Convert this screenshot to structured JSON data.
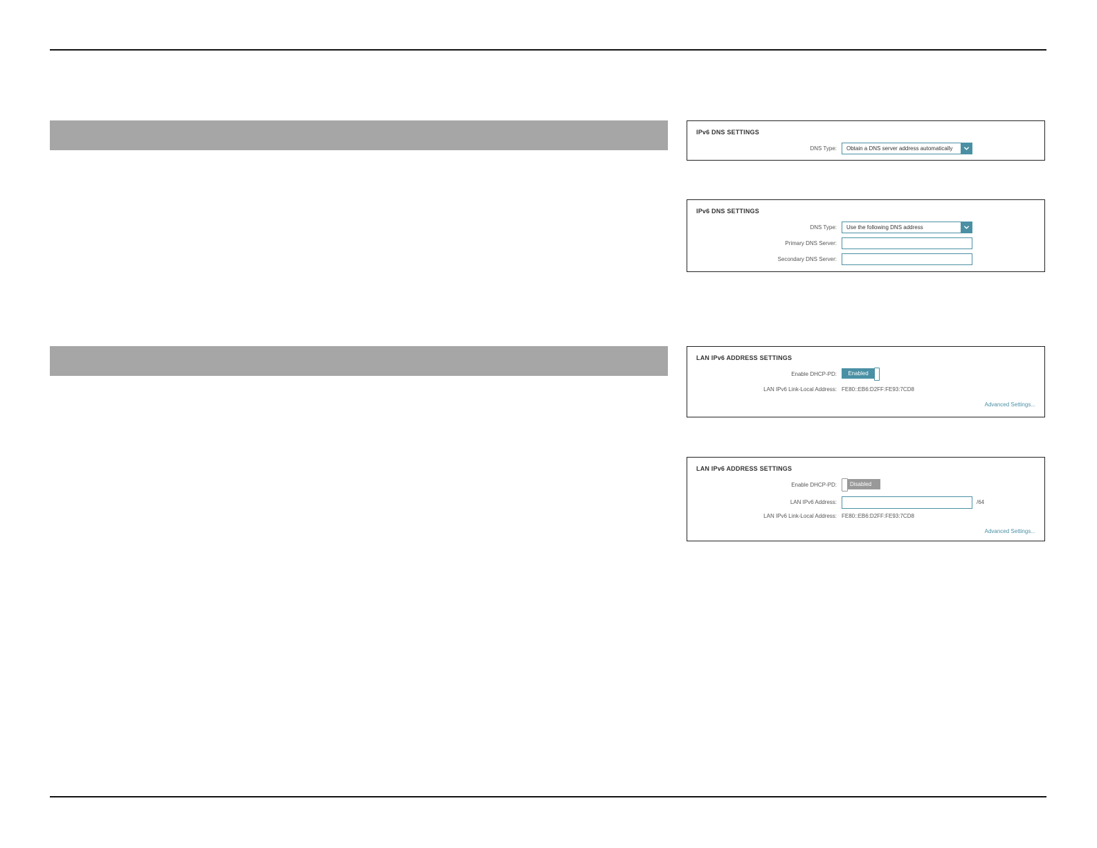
{
  "dns_panel_auto": {
    "title": "IPv6 DNS SETTINGS",
    "dns_type_label": "DNS Type:",
    "dns_type_value": "Obtain a DNS server address automatically"
  },
  "dns_panel_manual": {
    "title": "IPv6 DNS SETTINGS",
    "dns_type_label": "DNS Type:",
    "dns_type_value": "Use the following DNS address",
    "primary_label": "Primary DNS Server:",
    "primary_value": "",
    "secondary_label": "Secondary DNS Server:",
    "secondary_value": ""
  },
  "lan_panel_enabled": {
    "title": "LAN IPv6 ADDRESS SETTINGS",
    "dhcp_pd_label": "Enable DHCP-PD:",
    "dhcp_pd_state": "Enabled",
    "link_local_label": "LAN IPv6 Link-Local Address:",
    "link_local_value": "FE80::EB6:D2FF:FE93:7CD8",
    "advanced_link": "Advanced Settings..."
  },
  "lan_panel_disabled": {
    "title": "LAN IPv6 ADDRESS SETTINGS",
    "dhcp_pd_label": "Enable DHCP-PD:",
    "dhcp_pd_state": "Disabled",
    "lan_address_label": "LAN IPv6 Address:",
    "lan_address_value": "",
    "lan_address_suffix": "/64",
    "link_local_label": "LAN IPv6 Link-Local Address:",
    "link_local_value": "FE80::EB6:D2FF:FE93:7CD8",
    "advanced_link": "Advanced Settings..."
  },
  "colors": {
    "accent": "#4a90a4",
    "section_bar": "#a6a6a6",
    "toggle_off": "#999999"
  }
}
